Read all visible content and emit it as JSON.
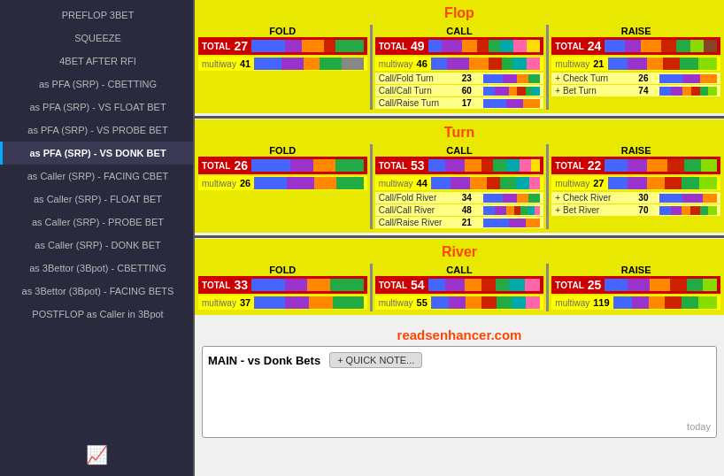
{
  "sidebar": {
    "items": [
      {
        "id": "preflop-3bet",
        "label": "PREFLOP 3BET",
        "active": false
      },
      {
        "id": "squeeze",
        "label": "SQUEEZE",
        "active": false
      },
      {
        "id": "4bet-after-rfi",
        "label": "4BET AFTER RFI",
        "active": false
      },
      {
        "id": "pfa-cbetting",
        "label": "as PFA (SRP) - CBETTING",
        "active": false
      },
      {
        "id": "pfa-vs-float",
        "label": "as PFA (SRP) - VS FLOAT BET",
        "active": false
      },
      {
        "id": "pfa-vs-probe",
        "label": "as PFA (SRP) - VS PROBE BET",
        "active": false
      },
      {
        "id": "pfa-vs-donk",
        "label": "as PFA (SRP) - VS DONK BET",
        "active": true
      },
      {
        "id": "caller-facing-cbet",
        "label": "as Caller (SRP) - FACING CBET",
        "active": false
      },
      {
        "id": "caller-float",
        "label": "as Caller (SRP) - FLOAT BET",
        "active": false
      },
      {
        "id": "caller-probe",
        "label": "as Caller (SRP) - PROBE BET",
        "active": false
      },
      {
        "id": "caller-donk",
        "label": "as Caller (SRP) - DONK BET",
        "active": false
      },
      {
        "id": "3bettor-cbetting",
        "label": "as 3Bettor (3Bpot) - CBETTING",
        "active": false
      },
      {
        "id": "3bettor-facing",
        "label": "as 3Bettor (3Bpot) - FACING BETS",
        "active": false
      },
      {
        "id": "postflop-caller",
        "label": "POSTFLOP as Caller in 3Bpot",
        "active": false
      }
    ]
  },
  "sections": {
    "flop": {
      "title": "Flop",
      "fold": {
        "header": "FOLD",
        "total": 27,
        "multiway": 41,
        "bars_total": [
          {
            "color": "#4466ff",
            "pct": 30
          },
          {
            "color": "#9933cc",
            "pct": 15
          },
          {
            "color": "#ff8800",
            "pct": 20
          },
          {
            "color": "#cc2200",
            "pct": 10
          },
          {
            "color": "#22aa44",
            "pct": 25
          }
        ],
        "bars_multi": [
          {
            "color": "#4466ff",
            "pct": 25
          },
          {
            "color": "#9933cc",
            "pct": 20
          },
          {
            "color": "#ff8800",
            "pct": 15
          },
          {
            "color": "#22aa44",
            "pct": 20
          },
          {
            "color": "#888888",
            "pct": 20
          }
        ]
      },
      "call": {
        "header": "CALL",
        "total": 49,
        "multiway": 46,
        "bars_total": [
          {
            "color": "#4466ff",
            "pct": 15
          },
          {
            "color": "#9933cc",
            "pct": 20
          },
          {
            "color": "#ff8800",
            "pct": 15
          },
          {
            "color": "#cc2200",
            "pct": 10
          },
          {
            "color": "#22aa44",
            "pct": 10
          },
          {
            "color": "#00aaaa",
            "pct": 10
          },
          {
            "color": "#ff66aa",
            "pct": 10
          },
          {
            "color": "#ffdd00",
            "pct": 10
          }
        ],
        "bars_multi": [
          {
            "color": "#4466ff",
            "pct": 15
          },
          {
            "color": "#9933cc",
            "pct": 20
          },
          {
            "color": "#ff8800",
            "pct": 20
          },
          {
            "color": "#cc2200",
            "pct": 15
          },
          {
            "color": "#22aa44",
            "pct": 10
          },
          {
            "color": "#00aaaa",
            "pct": 10
          },
          {
            "color": "#ff66aa",
            "pct": 10
          }
        ],
        "sub_rows": [
          {
            "label": "Call/Fold Turn",
            "value": 23
          },
          {
            "label": "Call/Call Turn",
            "value": 60
          },
          {
            "label": "Call/Raise Turn",
            "value": 17
          }
        ]
      },
      "raise": {
        "header": "RAISE",
        "total": 24,
        "multiway": 21,
        "bars_total": [
          {
            "color": "#4466ff",
            "pct": 20
          },
          {
            "color": "#9933cc",
            "pct": 15
          },
          {
            "color": "#ff8800",
            "pct": 20
          },
          {
            "color": "#cc2200",
            "pct": 15
          },
          {
            "color": "#22aa44",
            "pct": 10
          },
          {
            "color": "#88dd00",
            "pct": 10
          },
          {
            "color": "#884422",
            "pct": 10
          }
        ],
        "bars_multi": [
          {
            "color": "#4466ff",
            "pct": 20
          },
          {
            "color": "#9933cc",
            "pct": 20
          },
          {
            "color": "#ff8800",
            "pct": 15
          },
          {
            "color": "#cc2200",
            "pct": 15
          },
          {
            "color": "#22aa44",
            "pct": 15
          },
          {
            "color": "#88dd00",
            "pct": 15
          }
        ],
        "sub_rows": [
          {
            "label": "+ Check Turn",
            "value": 26
          },
          {
            "label": "+ Bet Turn",
            "value": 74
          }
        ]
      }
    },
    "turn": {
      "title": "Turn",
      "fold": {
        "header": "FOLD",
        "total": 26,
        "multiway": 26
      },
      "call": {
        "header": "CALL",
        "total": 53,
        "multiway": 44,
        "sub_rows": [
          {
            "label": "Call/Fold River",
            "value": 34
          },
          {
            "label": "Call/Call River",
            "value": 48
          },
          {
            "label": "Call/Raise River",
            "value": 21
          }
        ]
      },
      "raise": {
        "header": "RAISE",
        "total": 22,
        "multiway": 27,
        "sub_rows": [
          {
            "label": "+ Check River",
            "value": 30
          },
          {
            "label": "+ Bet River",
            "value": 70
          }
        ]
      }
    },
    "river": {
      "title": "River",
      "fold": {
        "header": "FOLD",
        "total": 33,
        "multiway": 37
      },
      "call": {
        "header": "CALL",
        "total": 54,
        "multiway": 55
      },
      "raise": {
        "header": "RAISE",
        "total": 25,
        "multiway": 119
      }
    }
  },
  "note_section": {
    "site_title": "readsenhancer.com",
    "main_label": "MAIN - vs Donk Bets",
    "quick_note_label": "+ QUICK NOTE...",
    "date_label": "today"
  }
}
